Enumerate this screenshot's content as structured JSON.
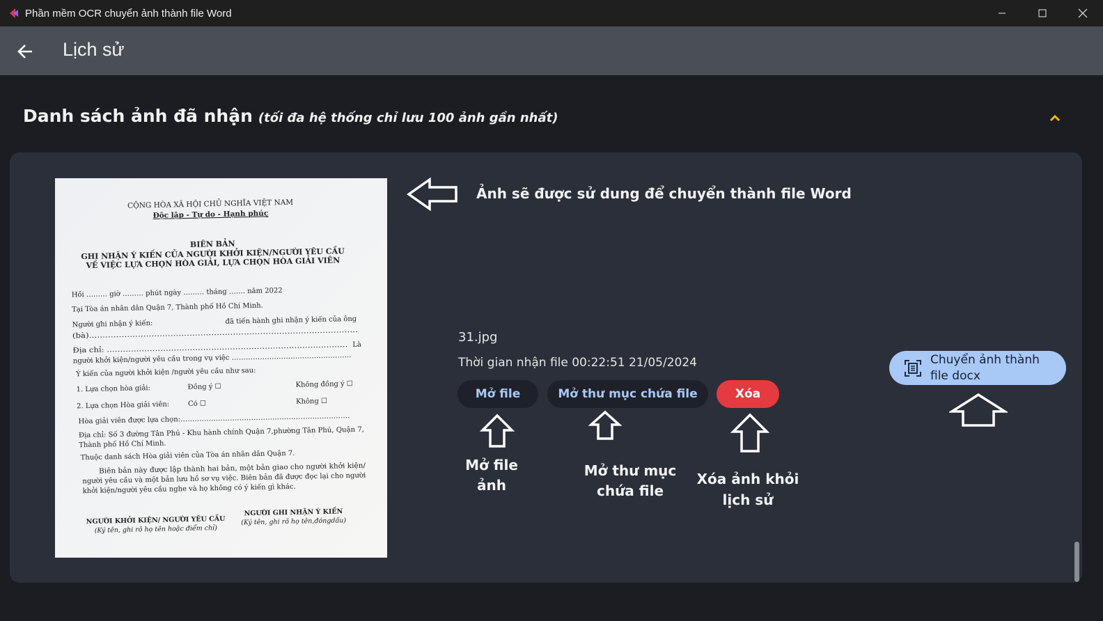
{
  "window": {
    "title": "Phần mềm OCR chuyển ảnh thành file Word",
    "minimize_icon": "minimize-icon",
    "maximize_icon": "maximize-icon",
    "close_icon": "close-icon"
  },
  "appbar": {
    "back_icon": "arrow-left-icon",
    "title": "Lịch sử"
  },
  "section": {
    "title": "Danh sách ảnh đã nhận",
    "note": "(tối đa hệ thống chỉ lưu 100 ảnh gần nhất)",
    "collapse_icon": "chevron-up-icon",
    "accent_color": "#f5b400"
  },
  "item": {
    "image_annotation": "Ảnh sẽ được sử dung để chuyển thành file Word",
    "file_name": "31.jpg",
    "received_time": "Thời gian nhận file 00:22:51 21/05/2024",
    "buttons": {
      "open_file": "Mở file",
      "open_folder": "Mở thư mục chứa file",
      "delete": "Xóa",
      "convert_line1": "Chuyển ảnh thành",
      "convert_line2": "file docx"
    },
    "annotations": {
      "open_file_line1": "Mở file",
      "open_file_line2": "ảnh",
      "open_folder_line1": "Mở thư mục",
      "open_folder_line2": "chứa file",
      "delete_line1": "Xóa ảnh khỏi",
      "delete_line2": "lịch sử"
    },
    "colors": {
      "delete_button": "#e53a3f",
      "convert_button": "#a8c8f5",
      "card_background": "#2b2f3a"
    }
  },
  "document": {
    "header1": "CỘNG HÒA XÃ HỘI CHỦ NGHĨA VIỆT NAM",
    "header2": "Độc lập - Tự do - Hạnh phúc",
    "title1": "BIÊN BẢN",
    "title2": "GHI NHẬN Ý KIẾN CỦA NGƯỜI KHỞI KIỆN/NGƯỜI YÊU CẦU",
    "title3": "VỀ VIỆC LỰA CHỌN HÒA GIẢI, LỰA CHỌN HÒA GIẢI VIÊN",
    "line1": "Hồi ……… giờ ……… phút ngày ……… tháng ……. năm 2022",
    "line2": "Tại Tòa án nhân dân Quận 7, Thành phố Hồ Chí Minh.",
    "line3a": "Người ghi nhận ý kiến:",
    "line3b": "đã tiến hành ghi nhận ý kiến của ông",
    "line4": "(bà)………………………………………………………………………………………",
    "line5a": "Địa chỉ: ………………………………………………………………………………",
    "line5b": "Là",
    "line6": "người khởi kiện/người yêu cầu trong vụ việc ……………………………………………",
    "line7": "Ý kiến của người khởi kiện /người yêu cầu như sau:",
    "line8a": "1. Lựa chọn hòa giải:",
    "line8b": "Đồng ý ☐",
    "line8c": "Không đồng ý ☐",
    "line9a": "2. Lựa chọn Hòa giải viên:",
    "line9b": "Có ☐",
    "line9c": "Không ☐",
    "line10": "Hòa giải viên được lựa chọn:………………………………………………………………",
    "line11": "Địa chỉ: Số 3 đường Tân Phú - Khu hành chính Quận 7,phường Tân Phú, Quận 7,",
    "line12": "Thành phố Hồ Chí Minh.",
    "line13": "Thuộc danh sách Hòa giải viên của Tòa án nhân dân Quận 7.",
    "line14": "Biên bản này được lập thành hai bản, một bản giao cho người khởi kiện/",
    "line15": "người yêu cầu và một bản lưu hồ sơ vụ việc. Biên bản đã được đọc lại cho người",
    "line16": "khởi kiện/người yêu cầu nghe và họ không có ý kiến gì khác.",
    "sign1a": "NGƯỜI KHỞI KIỆN/ NGƯỜI YÊU CẦU",
    "sign1b": "(Ký tên, ghi rõ họ tên hoặc điểm chỉ)",
    "sign2a": "NGƯỜI GHI NHẬN Ý KIẾN",
    "sign2b": "(Ký tên, ghi rõ họ tên,đóngdấu)"
  }
}
